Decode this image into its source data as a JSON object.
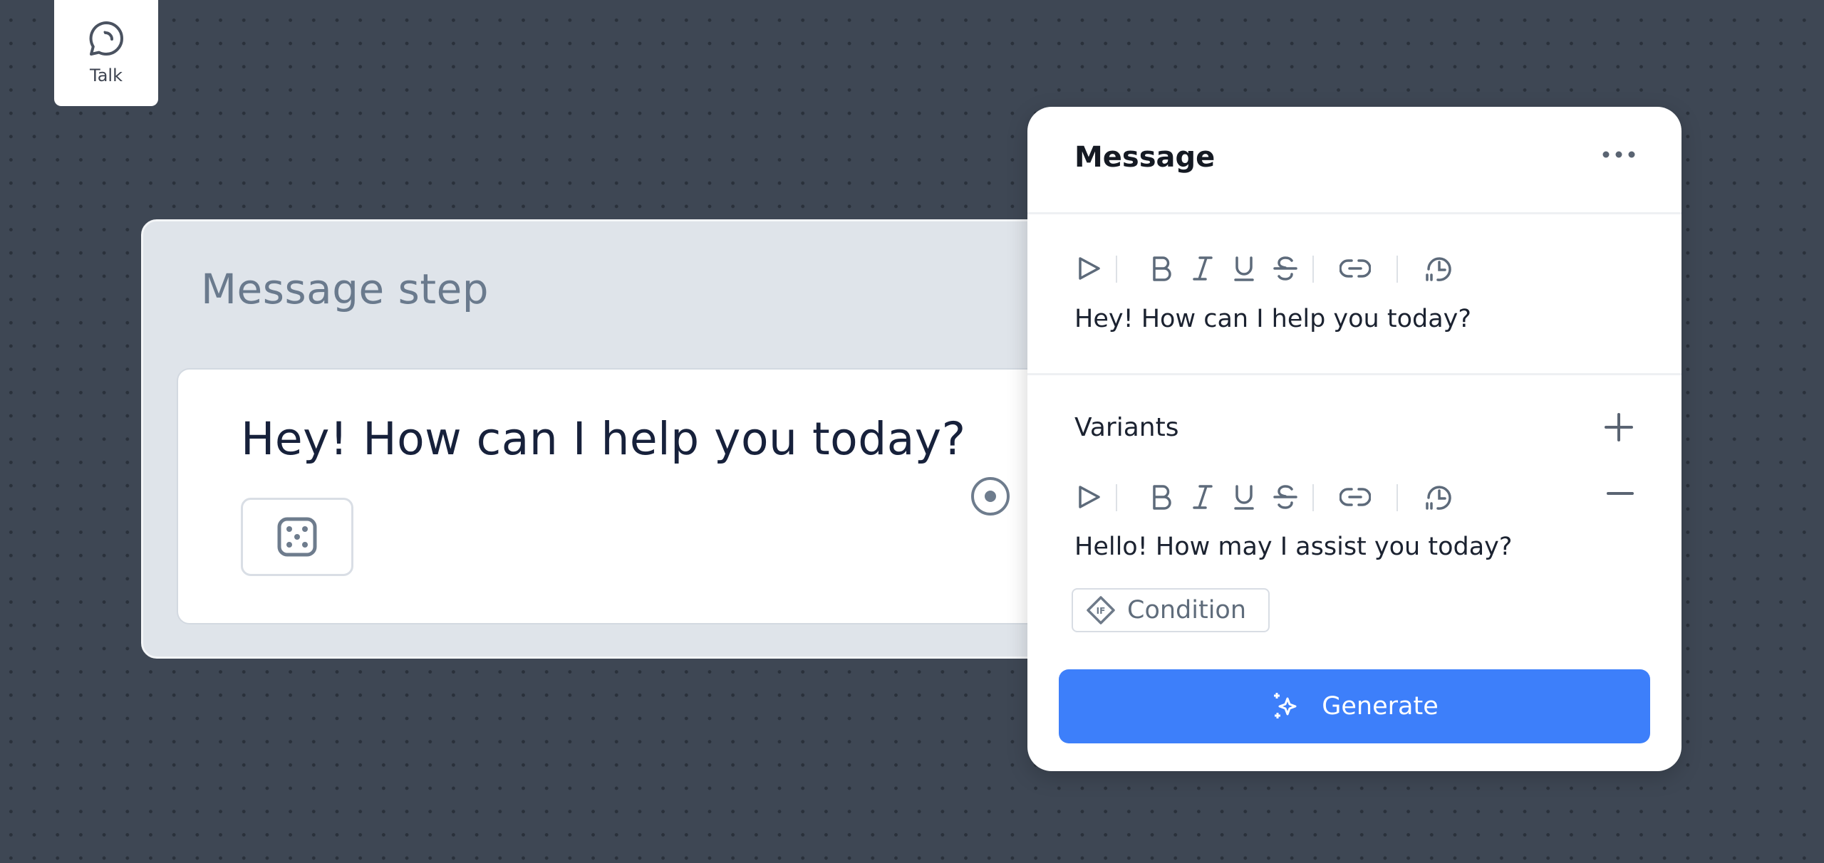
{
  "sidebar": {
    "talk_label": "Talk",
    "talk_icon": "chat-bubble-icon"
  },
  "canvas": {
    "step_title": "Message step",
    "step_message": "Hey! How can I help you today?",
    "dice_icon": "dice-icon",
    "connector_icon": "output-port-icon"
  },
  "panel": {
    "title": "Message",
    "more_icon": "more-icon",
    "toolbar_icons": [
      "play-icon",
      "bold-icon",
      "italic-icon",
      "underline-icon",
      "strikethrough-icon",
      "link-icon",
      "delay-icon"
    ],
    "message_text": "Hey! How can I help you today?",
    "variants_label": "Variants",
    "variant_text": "Hello! How may I assist you today?",
    "condition_label": "Condition",
    "generate_label": "Generate"
  },
  "colors": {
    "accent": "#3d7ffa",
    "background": "#3e4754",
    "step_card": "#dfe4ea"
  }
}
